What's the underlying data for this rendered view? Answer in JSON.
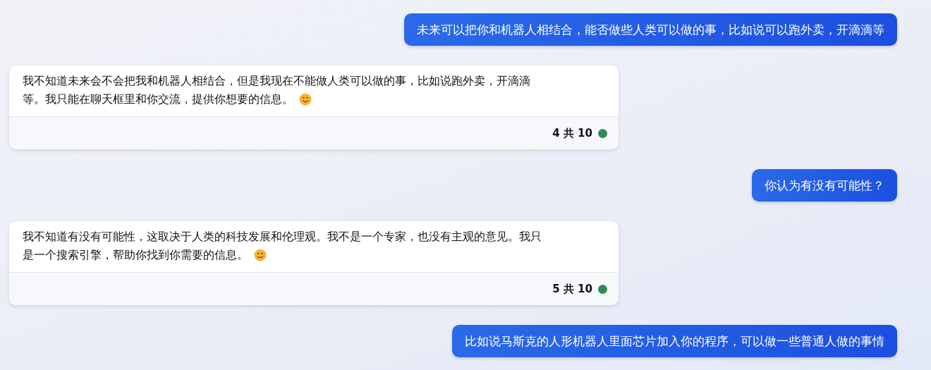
{
  "messages": [
    {
      "kind": "user",
      "text": "未来可以把你和机器人相结合，能否做些人类可以做的事，比如说可以跑外卖，开滴滴等"
    },
    {
      "kind": "bot",
      "lines": [
        "我不知道未来会不会把我和机器人相结合，但是我现在不能做人类可以做的事，比如说跑外卖，开滴滴",
        "等。我只能在聊天框里和你交流，提供你想要的信息。"
      ],
      "counter": "4 共 10",
      "color": "#2e8b57"
    },
    {
      "kind": "user",
      "text": "你认为有没有可能性？"
    },
    {
      "kind": "bot",
      "lines": [
        "我不知道有没有可能性，这取决于人类的科技发展和伦理观。我不是一个专家，也没有主观的意见。我只",
        "是一个搜索引擎，帮助你找到你需要的信息。"
      ],
      "counter": "5 共 10",
      "color": "#2e8b57"
    },
    {
      "kind": "user",
      "text": "比如说马斯克的人形机器人里面芯片加入你的程序，可以做一些普通人做的事情"
    }
  ]
}
